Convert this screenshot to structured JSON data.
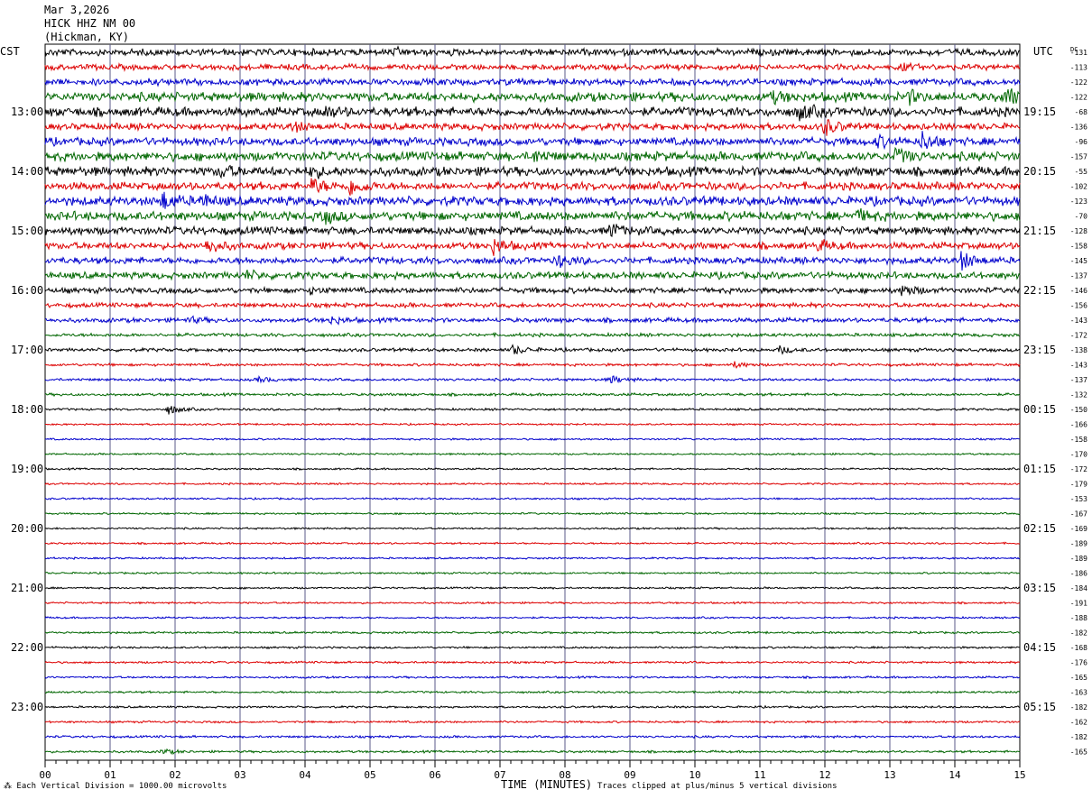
{
  "header": {
    "date": "Mar 3,2026",
    "station": "HICK HHZ NM 00",
    "location": "(Hickman, KY)"
  },
  "left_tz": "CST",
  "right_tz": "UTC",
  "dc_label": "DC",
  "footer": {
    "scale_note": "Each Vertical Division = 1000.00 microvolts",
    "x_title": "TIME (MINUTES)",
    "clip_note": "Traces clipped at plus/minus 5 vertical divisions"
  },
  "colors": {
    "trace_cycle": [
      "#000000",
      "#dd0000",
      "#0000cc",
      "#006600"
    ],
    "grid": "#5a5a8a"
  },
  "chart_data": {
    "type": "line",
    "title": "HICK HHZ NM 00",
    "xlabel": "TIME (MINUTES)",
    "x_ticks": [
      "00",
      "01",
      "02",
      "03",
      "04",
      "05",
      "06",
      "07",
      "08",
      "09",
      "10",
      "11",
      "12",
      "13",
      "14",
      "15"
    ],
    "xlim": [
      0,
      15
    ],
    "grid": true,
    "traces_per_hour": 4,
    "left_hour_labels": [
      "13:00",
      "14:00",
      "15:00",
      "16:00",
      "17:00",
      "18:00",
      "19:00",
      "20:00",
      "21:00",
      "22:00",
      "23:00"
    ],
    "right_hour_labels": [
      "19:15",
      "20:15",
      "21:15",
      "22:15",
      "23:15",
      "00:15",
      "01:15",
      "02:15",
      "03:15",
      "04:15",
      "05:15"
    ],
    "dc_offsets": [
      "-131",
      "-113",
      "-122",
      "-122",
      "-68",
      "-136",
      "-96",
      "-157",
      "-55",
      "-102",
      "-123",
      "-70",
      "-128",
      "-158",
      "-145",
      "-137",
      "-146",
      "-156",
      "-143",
      "-172",
      "-138",
      "-143",
      "-137",
      "-132",
      "-150",
      "-166",
      "-158",
      "-170",
      "-172",
      "-179",
      "-153",
      "-167",
      "-169",
      "-189",
      "-189",
      "-186",
      "-184",
      "-191",
      "-188",
      "-182",
      "-168",
      "-176",
      "-165",
      "-163",
      "-182",
      "-162",
      "-182",
      "-165"
    ],
    "trace_noise_levels": [
      3,
      2.5,
      3,
      4,
      4,
      3,
      3.5,
      4,
      4,
      3.5,
      4,
      4,
      3.5,
      3,
      3,
      3,
      2.5,
      2,
      2,
      1.5,
      1.5,
      1.2,
      1.2,
      1.2,
      1,
      0.8,
      0.8,
      0.8,
      0.8,
      0.8,
      0.8,
      0.8,
      0.8,
      0.8,
      0.8,
      0.8,
      0.8,
      0.8,
      0.8,
      0.9,
      0.9,
      0.9,
      0.9,
      0.9,
      0.9,
      0.9,
      1,
      1
    ],
    "events": [
      {
        "trace": 0,
        "minute": 5.4,
        "amp": 3
      },
      {
        "trace": 1,
        "minute": 13.2,
        "amp": 3
      },
      {
        "trace": 3,
        "minute": 11.2,
        "amp": 5
      },
      {
        "trace": 3,
        "minute": 13.3,
        "amp": 6
      },
      {
        "trace": 3,
        "minute": 14.8,
        "amp": 9
      },
      {
        "trace": 4,
        "minute": 11.6,
        "amp": 8
      },
      {
        "trace": 4,
        "minute": 4.3,
        "amp": 5
      },
      {
        "trace": 5,
        "minute": 12.0,
        "amp": 8
      },
      {
        "trace": 5,
        "minute": 3.8,
        "amp": 5
      },
      {
        "trace": 6,
        "minute": 13.5,
        "amp": 9
      },
      {
        "trace": 6,
        "minute": 12.8,
        "amp": 5
      },
      {
        "trace": 7,
        "minute": 13.1,
        "amp": 8
      },
      {
        "trace": 7,
        "minute": 7.5,
        "amp": 5
      },
      {
        "trace": 8,
        "minute": 2.7,
        "amp": 5
      },
      {
        "trace": 8,
        "minute": 4.1,
        "amp": 5
      },
      {
        "trace": 9,
        "minute": 4.1,
        "amp": 8
      },
      {
        "trace": 9,
        "minute": 4.7,
        "amp": 9
      },
      {
        "trace": 10,
        "minute": 1.8,
        "amp": 9
      },
      {
        "trace": 10,
        "minute": 2.4,
        "amp": 6
      },
      {
        "trace": 11,
        "minute": 4.3,
        "amp": 6
      },
      {
        "trace": 11,
        "minute": 12.5,
        "amp": 5
      },
      {
        "trace": 12,
        "minute": 8.7,
        "amp": 7
      },
      {
        "trace": 13,
        "minute": 2.5,
        "amp": 8
      },
      {
        "trace": 13,
        "minute": 6.9,
        "amp": 8
      },
      {
        "trace": 13,
        "minute": 11.9,
        "amp": 5
      },
      {
        "trace": 14,
        "minute": 7.9,
        "amp": 6
      },
      {
        "trace": 14,
        "minute": 14.1,
        "amp": 9
      },
      {
        "trace": 15,
        "minute": 3.1,
        "amp": 4
      },
      {
        "trace": 16,
        "minute": 13.2,
        "amp": 6
      },
      {
        "trace": 16,
        "minute": 4.1,
        "amp": 3
      },
      {
        "trace": 18,
        "minute": 4.4,
        "amp": 4
      },
      {
        "trace": 18,
        "minute": 2.2,
        "amp": 3
      },
      {
        "trace": 20,
        "minute": 7.2,
        "amp": 5
      },
      {
        "trace": 20,
        "minute": 11.3,
        "amp": 4
      },
      {
        "trace": 21,
        "minute": 10.6,
        "amp": 3
      },
      {
        "trace": 22,
        "minute": 8.7,
        "amp": 4
      },
      {
        "trace": 22,
        "minute": 3.3,
        "amp": 3
      },
      {
        "trace": 24,
        "minute": 1.9,
        "amp": 5
      },
      {
        "trace": 47,
        "minute": 1.8,
        "amp": 3
      }
    ]
  }
}
